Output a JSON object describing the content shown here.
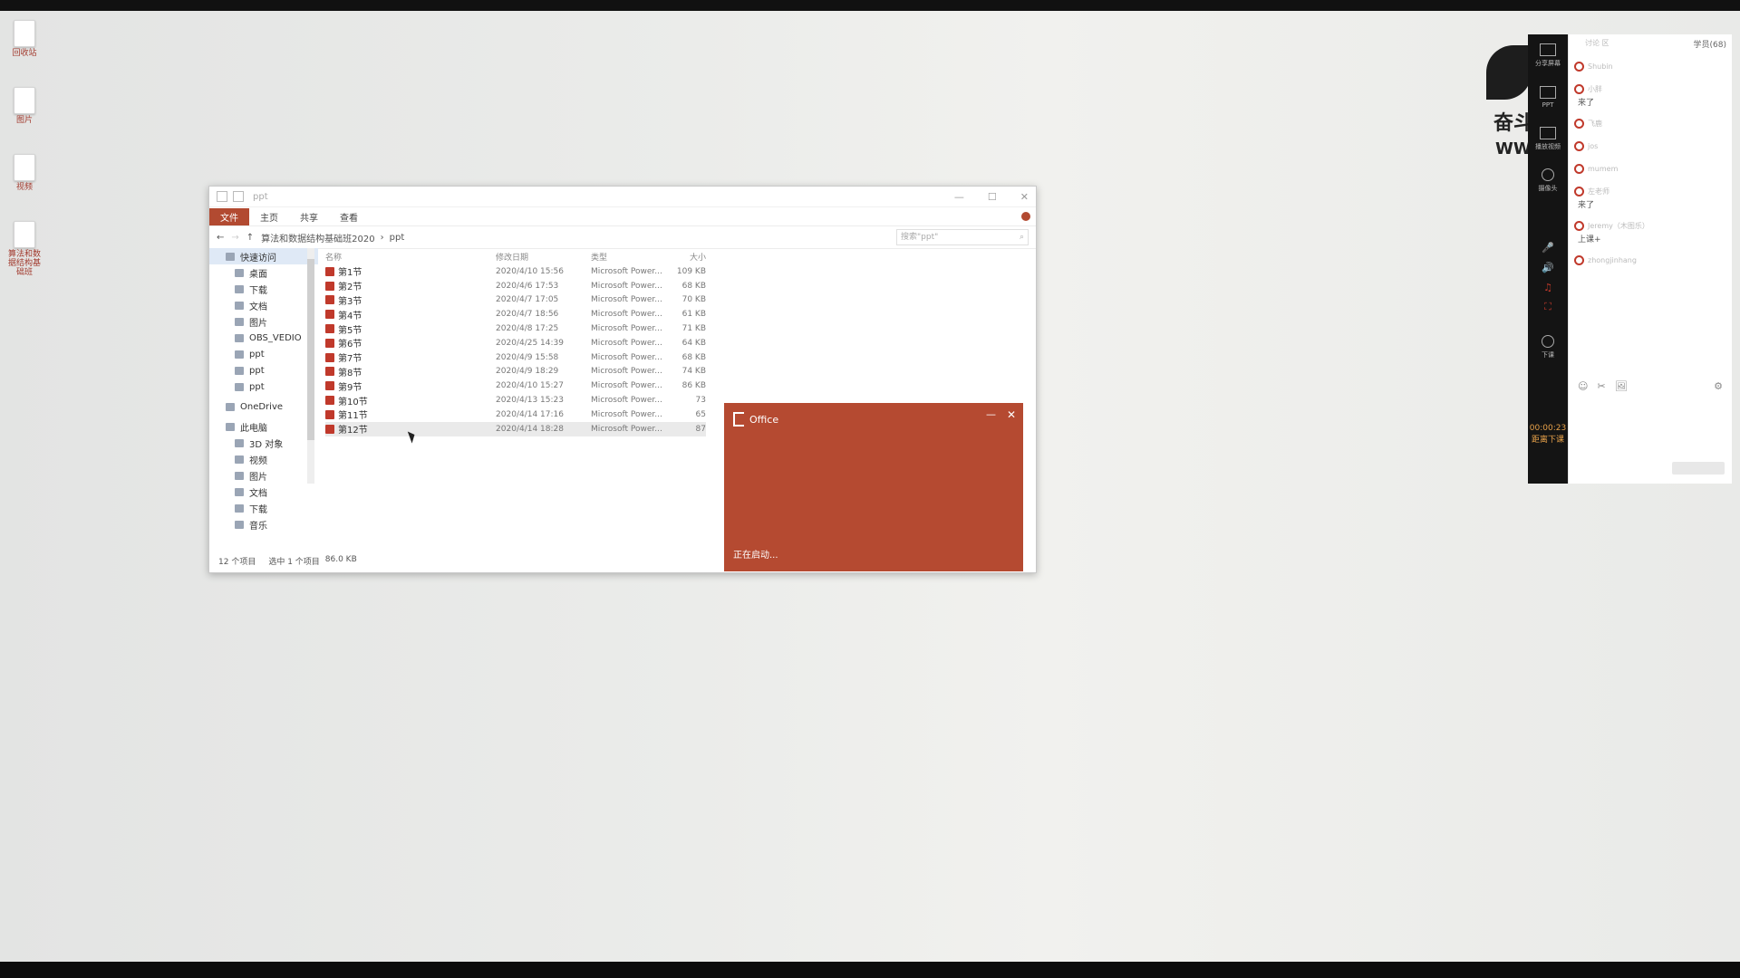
{
  "desktop": {
    "icons": [
      {
        "label": "回收站"
      },
      {
        "label": "图片"
      },
      {
        "label": "视频"
      },
      {
        "label": "算法和数据结构基础班"
      }
    ]
  },
  "explorer": {
    "title": "ppt",
    "window_controls": {
      "minimize": "—",
      "maximize": "☐",
      "close": "✕"
    },
    "ribbon": {
      "tabs": [
        "文件",
        "主页",
        "共享",
        "查看"
      ]
    },
    "address": {
      "back": "←",
      "forward": "→",
      "up": "↑",
      "path": [
        "算法和数据结构基础班2020",
        "ppt"
      ],
      "search_placeholder": "搜索\"ppt\""
    },
    "nav": {
      "quick_access": "快速访问",
      "quick_items": [
        "桌面",
        "下载",
        "文档",
        "图片",
        "OBS_VEDIO",
        "ppt",
        "ppt",
        "ppt"
      ],
      "onedrive": "OneDrive",
      "this_pc": "此电脑",
      "pc_items": [
        "3D 对象",
        "视频",
        "图片",
        "文档",
        "下载",
        "音乐"
      ]
    },
    "columns": {
      "name": "名称",
      "date": "修改日期",
      "type": "类型",
      "size": "大小"
    },
    "files": [
      {
        "name": "第1节",
        "date": "2020/4/10 15:56",
        "type": "Microsoft Power...",
        "size": "109 KB"
      },
      {
        "name": "第2节",
        "date": "2020/4/6 17:53",
        "type": "Microsoft Power...",
        "size": "68 KB"
      },
      {
        "name": "第3节",
        "date": "2020/4/7 17:05",
        "type": "Microsoft Power...",
        "size": "70 KB"
      },
      {
        "name": "第4节",
        "date": "2020/4/7 18:56",
        "type": "Microsoft Power...",
        "size": "61 KB"
      },
      {
        "name": "第5节",
        "date": "2020/4/8 17:25",
        "type": "Microsoft Power...",
        "size": "71 KB"
      },
      {
        "name": "第6节",
        "date": "2020/4/25 14:39",
        "type": "Microsoft Power...",
        "size": "64 KB"
      },
      {
        "name": "第7节",
        "date": "2020/4/9 15:58",
        "type": "Microsoft Power...",
        "size": "68 KB"
      },
      {
        "name": "第8节",
        "date": "2020/4/9 18:29",
        "type": "Microsoft Power...",
        "size": "74 KB"
      },
      {
        "name": "第9节",
        "date": "2020/4/10 15:27",
        "type": "Microsoft Power...",
        "size": "86 KB"
      },
      {
        "name": "第10节",
        "date": "2020/4/13 15:23",
        "type": "Microsoft Power...",
        "size": "73"
      },
      {
        "name": "第11节",
        "date": "2020/4/14 17:16",
        "type": "Microsoft Power...",
        "size": "65"
      },
      {
        "name": "第12节",
        "date": "2020/4/14 18:28",
        "type": "Microsoft Power...",
        "size": "87"
      }
    ],
    "status": {
      "count": "12 个项目",
      "selected": "选中 1 个项目",
      "size": "86.0 KB"
    }
  },
  "office_splash": {
    "brand": "Office",
    "status": "正在启动...",
    "minimize": "—",
    "close": "✕"
  },
  "stream_panel": {
    "logo_text": "奋斗",
    "logo_www": "WW",
    "buttons": [
      {
        "label": "分享屏幕"
      },
      {
        "label": "PPT"
      },
      {
        "label": "播放视频"
      },
      {
        "label": "摄像头"
      }
    ],
    "controls": [
      "🎤",
      "🔊",
      "♫",
      "⛶"
    ],
    "download_label": "下课",
    "timer": "00:00:23",
    "timer_sub": "距离下课"
  },
  "chat": {
    "header_left": "讨论 区",
    "count_label": "学员(68)",
    "messages": [
      {
        "user": "Shubin",
        "text": ""
      },
      {
        "user": "小胖",
        "text": "来了"
      },
      {
        "user": "飞鹿",
        "text": ""
      },
      {
        "user": "jos",
        "text": ""
      },
      {
        "user": "mumem",
        "text": ""
      },
      {
        "user": "左老师",
        "text": "来了"
      },
      {
        "user": "Jeremy（木图乐）",
        "text": "上课+"
      },
      {
        "user": "zhongjinhang",
        "text": ""
      }
    ],
    "tools": [
      "☺",
      "✂",
      "🖼",
      "⚙"
    ]
  }
}
